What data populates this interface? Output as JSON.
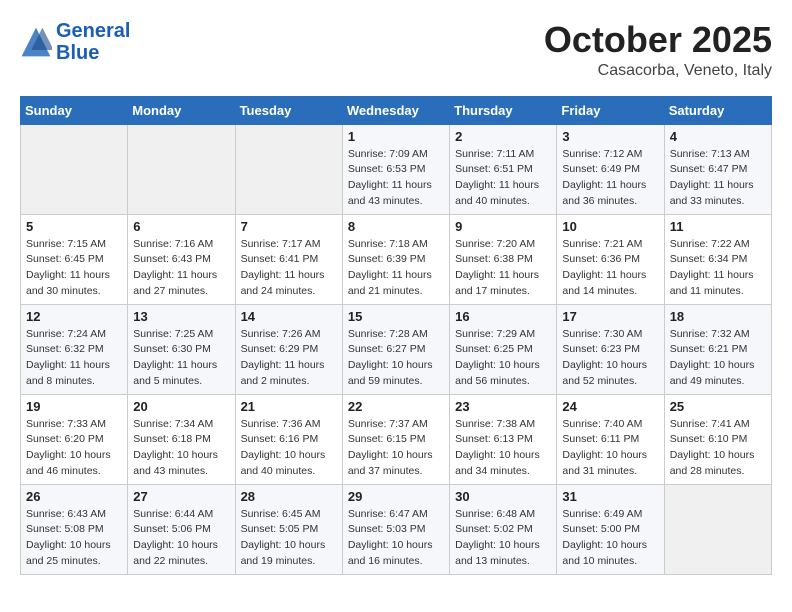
{
  "header": {
    "logo_line1": "General",
    "logo_line2": "Blue",
    "month": "October 2025",
    "location": "Casacorba, Veneto, Italy"
  },
  "weekdays": [
    "Sunday",
    "Monday",
    "Tuesday",
    "Wednesday",
    "Thursday",
    "Friday",
    "Saturday"
  ],
  "weeks": [
    [
      {
        "day": "",
        "sunrise": "",
        "sunset": "",
        "daylight": ""
      },
      {
        "day": "",
        "sunrise": "",
        "sunset": "",
        "daylight": ""
      },
      {
        "day": "",
        "sunrise": "",
        "sunset": "",
        "daylight": ""
      },
      {
        "day": "1",
        "sunrise": "Sunrise: 7:09 AM",
        "sunset": "Sunset: 6:53 PM",
        "daylight": "Daylight: 11 hours and 43 minutes."
      },
      {
        "day": "2",
        "sunrise": "Sunrise: 7:11 AM",
        "sunset": "Sunset: 6:51 PM",
        "daylight": "Daylight: 11 hours and 40 minutes."
      },
      {
        "day": "3",
        "sunrise": "Sunrise: 7:12 AM",
        "sunset": "Sunset: 6:49 PM",
        "daylight": "Daylight: 11 hours and 36 minutes."
      },
      {
        "day": "4",
        "sunrise": "Sunrise: 7:13 AM",
        "sunset": "Sunset: 6:47 PM",
        "daylight": "Daylight: 11 hours and 33 minutes."
      }
    ],
    [
      {
        "day": "5",
        "sunrise": "Sunrise: 7:15 AM",
        "sunset": "Sunset: 6:45 PM",
        "daylight": "Daylight: 11 hours and 30 minutes."
      },
      {
        "day": "6",
        "sunrise": "Sunrise: 7:16 AM",
        "sunset": "Sunset: 6:43 PM",
        "daylight": "Daylight: 11 hours and 27 minutes."
      },
      {
        "day": "7",
        "sunrise": "Sunrise: 7:17 AM",
        "sunset": "Sunset: 6:41 PM",
        "daylight": "Daylight: 11 hours and 24 minutes."
      },
      {
        "day": "8",
        "sunrise": "Sunrise: 7:18 AM",
        "sunset": "Sunset: 6:39 PM",
        "daylight": "Daylight: 11 hours and 21 minutes."
      },
      {
        "day": "9",
        "sunrise": "Sunrise: 7:20 AM",
        "sunset": "Sunset: 6:38 PM",
        "daylight": "Daylight: 11 hours and 17 minutes."
      },
      {
        "day": "10",
        "sunrise": "Sunrise: 7:21 AM",
        "sunset": "Sunset: 6:36 PM",
        "daylight": "Daylight: 11 hours and 14 minutes."
      },
      {
        "day": "11",
        "sunrise": "Sunrise: 7:22 AM",
        "sunset": "Sunset: 6:34 PM",
        "daylight": "Daylight: 11 hours and 11 minutes."
      }
    ],
    [
      {
        "day": "12",
        "sunrise": "Sunrise: 7:24 AM",
        "sunset": "Sunset: 6:32 PM",
        "daylight": "Daylight: 11 hours and 8 minutes."
      },
      {
        "day": "13",
        "sunrise": "Sunrise: 7:25 AM",
        "sunset": "Sunset: 6:30 PM",
        "daylight": "Daylight: 11 hours and 5 minutes."
      },
      {
        "day": "14",
        "sunrise": "Sunrise: 7:26 AM",
        "sunset": "Sunset: 6:29 PM",
        "daylight": "Daylight: 11 hours and 2 minutes."
      },
      {
        "day": "15",
        "sunrise": "Sunrise: 7:28 AM",
        "sunset": "Sunset: 6:27 PM",
        "daylight": "Daylight: 10 hours and 59 minutes."
      },
      {
        "day": "16",
        "sunrise": "Sunrise: 7:29 AM",
        "sunset": "Sunset: 6:25 PM",
        "daylight": "Daylight: 10 hours and 56 minutes."
      },
      {
        "day": "17",
        "sunrise": "Sunrise: 7:30 AM",
        "sunset": "Sunset: 6:23 PM",
        "daylight": "Daylight: 10 hours and 52 minutes."
      },
      {
        "day": "18",
        "sunrise": "Sunrise: 7:32 AM",
        "sunset": "Sunset: 6:21 PM",
        "daylight": "Daylight: 10 hours and 49 minutes."
      }
    ],
    [
      {
        "day": "19",
        "sunrise": "Sunrise: 7:33 AM",
        "sunset": "Sunset: 6:20 PM",
        "daylight": "Daylight: 10 hours and 46 minutes."
      },
      {
        "day": "20",
        "sunrise": "Sunrise: 7:34 AM",
        "sunset": "Sunset: 6:18 PM",
        "daylight": "Daylight: 10 hours and 43 minutes."
      },
      {
        "day": "21",
        "sunrise": "Sunrise: 7:36 AM",
        "sunset": "Sunset: 6:16 PM",
        "daylight": "Daylight: 10 hours and 40 minutes."
      },
      {
        "day": "22",
        "sunrise": "Sunrise: 7:37 AM",
        "sunset": "Sunset: 6:15 PM",
        "daylight": "Daylight: 10 hours and 37 minutes."
      },
      {
        "day": "23",
        "sunrise": "Sunrise: 7:38 AM",
        "sunset": "Sunset: 6:13 PM",
        "daylight": "Daylight: 10 hours and 34 minutes."
      },
      {
        "day": "24",
        "sunrise": "Sunrise: 7:40 AM",
        "sunset": "Sunset: 6:11 PM",
        "daylight": "Daylight: 10 hours and 31 minutes."
      },
      {
        "day": "25",
        "sunrise": "Sunrise: 7:41 AM",
        "sunset": "Sunset: 6:10 PM",
        "daylight": "Daylight: 10 hours and 28 minutes."
      }
    ],
    [
      {
        "day": "26",
        "sunrise": "Sunrise: 6:43 AM",
        "sunset": "Sunset: 5:08 PM",
        "daylight": "Daylight: 10 hours and 25 minutes."
      },
      {
        "day": "27",
        "sunrise": "Sunrise: 6:44 AM",
        "sunset": "Sunset: 5:06 PM",
        "daylight": "Daylight: 10 hours and 22 minutes."
      },
      {
        "day": "28",
        "sunrise": "Sunrise: 6:45 AM",
        "sunset": "Sunset: 5:05 PM",
        "daylight": "Daylight: 10 hours and 19 minutes."
      },
      {
        "day": "29",
        "sunrise": "Sunrise: 6:47 AM",
        "sunset": "Sunset: 5:03 PM",
        "daylight": "Daylight: 10 hours and 16 minutes."
      },
      {
        "day": "30",
        "sunrise": "Sunrise: 6:48 AM",
        "sunset": "Sunset: 5:02 PM",
        "daylight": "Daylight: 10 hours and 13 minutes."
      },
      {
        "day": "31",
        "sunrise": "Sunrise: 6:49 AM",
        "sunset": "Sunset: 5:00 PM",
        "daylight": "Daylight: 10 hours and 10 minutes."
      },
      {
        "day": "",
        "sunrise": "",
        "sunset": "",
        "daylight": ""
      }
    ]
  ]
}
